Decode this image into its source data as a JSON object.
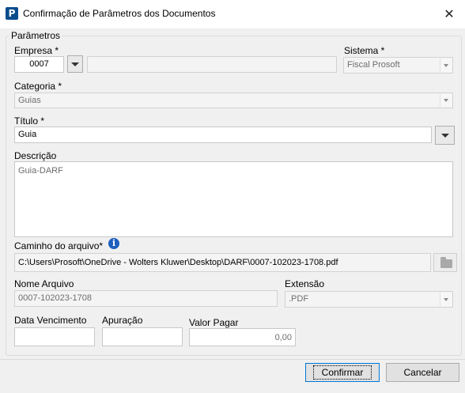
{
  "window": {
    "title": "Confirmação de Parâmetros dos Documentos",
    "icon": "prosoft-app-icon",
    "close_glyph": "✕"
  },
  "group": {
    "legend": "Parâmetros"
  },
  "empresa": {
    "label": "Empresa *",
    "code": "0007",
    "name": ""
  },
  "sistema": {
    "label": "Sistema *",
    "value": "Fiscal Prosoft"
  },
  "categoria": {
    "label": "Categoria *",
    "value": "Guias"
  },
  "titulo": {
    "label": "Título *",
    "value": "Guia"
  },
  "descricao": {
    "label": "Descrição",
    "value": "Guia-DARF"
  },
  "caminho": {
    "label": "Caminho do arquivo*",
    "value": "C:\\Users\\Prosoft\\OneDrive - Wolters Kluwer\\Desktop\\DARF\\0007-102023-1708.pdf"
  },
  "nome_arquivo": {
    "label": "Nome Arquivo",
    "value": "0007-102023-1708"
  },
  "extensao": {
    "label": "Extensão",
    "value": ".PDF"
  },
  "data_vencimento": {
    "label": "Data Vencimento",
    "value": ""
  },
  "apuracao": {
    "label": "Apuração",
    "value": ""
  },
  "valor_pagar": {
    "label": "Valor Pagar",
    "value": "0,00"
  },
  "buttons": {
    "confirm": "Confirmar",
    "cancel": "Cancelar"
  }
}
